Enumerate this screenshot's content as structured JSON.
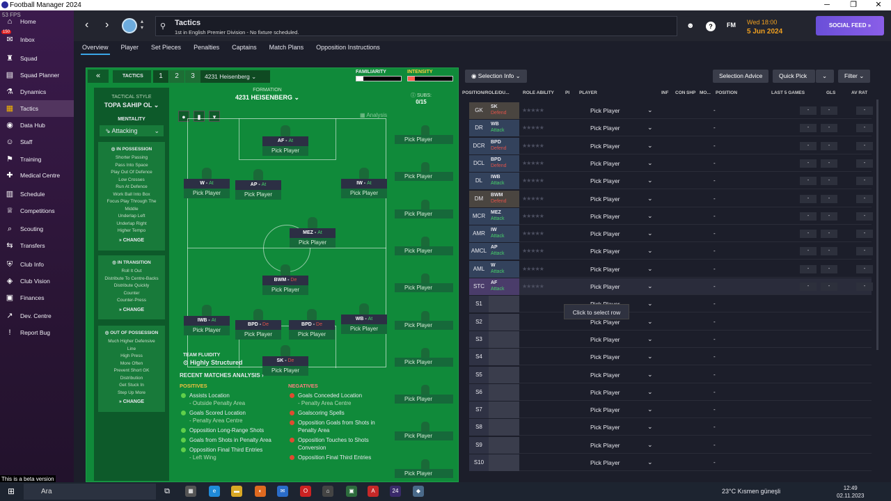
{
  "window": {
    "title": "Football Manager 2024",
    "minimize": "─",
    "maximize": "❐",
    "close": "✕"
  },
  "fps": "53 FPS",
  "beta": "This is a beta version",
  "sidebar": {
    "items": [
      {
        "label": "Home",
        "icon": "⌂"
      },
      {
        "label": "Inbox",
        "icon": "✉",
        "badge": "150"
      },
      {
        "label": "Squad",
        "icon": "♜"
      },
      {
        "label": "Squad Planner",
        "icon": "▤"
      },
      {
        "label": "Dynamics",
        "icon": "⚗"
      },
      {
        "label": "Tactics",
        "icon": "▦"
      },
      {
        "label": "Data Hub",
        "icon": "◉"
      },
      {
        "label": "Staff",
        "icon": "☺"
      },
      {
        "label": "Training",
        "icon": "⚑"
      },
      {
        "label": "Medical Centre",
        "icon": "✚"
      },
      {
        "label": "Schedule",
        "icon": "▥"
      },
      {
        "label": "Competitions",
        "icon": "♕"
      },
      {
        "label": "Scouting",
        "icon": "⌕"
      },
      {
        "label": "Transfers",
        "icon": "⇆"
      },
      {
        "label": "Club Info",
        "icon": "⛨"
      },
      {
        "label": "Club Vision",
        "icon": "◈"
      },
      {
        "label": "Finances",
        "icon": "▣"
      },
      {
        "label": "Dev. Centre",
        "icon": "↗"
      },
      {
        "label": "Report Bug",
        "icon": "!"
      }
    ]
  },
  "header": {
    "title": "Tactics",
    "subtitle": "1st in English Premier Division - No fixture scheduled.",
    "fm": "FM",
    "day": "Wed 18:00",
    "date": "5 Jun 2024",
    "social": "SOCIAL FEED »"
  },
  "tabs": [
    "Overview",
    "Player",
    "Set Pieces",
    "Penalties",
    "Captains",
    "Match Plans",
    "Opposition Instructions"
  ],
  "tactic": {
    "label": "TACTICS",
    "slots": [
      "1",
      "2",
      "3"
    ],
    "name": "4231 Heisenberg",
    "familiarity": "FAMILIARITY",
    "intensity": "INTENSITY",
    "familiarity_level": 0.15,
    "intensity_level": 0.15
  },
  "style": {
    "label": "TACTICAL STYLE",
    "value": "TOPA SAHIP OL",
    "mentality_label": "MENTALITY",
    "mentality": "Attacking"
  },
  "in_possession": {
    "title": "IN POSSESSION",
    "items": [
      "Shorter Passing",
      "Pass Into Space",
      "Play Out Of Defence",
      "Low Crosses",
      "Run At Defence",
      "Work Ball Into Box",
      "Focus Play Through The",
      "Middle",
      "Underlap Left",
      "Underlap Right",
      "Higher Tempo"
    ],
    "change": "CHANGE"
  },
  "in_transition": {
    "title": "IN TRANSITION",
    "items": [
      "Roll It Out",
      "Distribute To Centre-Backs",
      "Distribute Quickly",
      "Counter",
      "Counter-Press"
    ],
    "change": "CHANGE"
  },
  "out_possession": {
    "title": "OUT OF POSSESSION",
    "items": [
      "Much Higher Defensive",
      "Line",
      "High Press",
      "More Often",
      "Prevent Short GK",
      "Distribution",
      "Get Stuck In",
      "Step Up More"
    ],
    "change": "CHANGE"
  },
  "formation": {
    "label": "FORMATION",
    "name": "4231 HEISENBERG",
    "subs_label": "SUBS:",
    "subs": "0/15",
    "analysis": "Analysis"
  },
  "pick": "Pick Player",
  "players": [
    {
      "role": "AF",
      "duty": "At"
    },
    {
      "role": "W",
      "duty": "At"
    },
    {
      "role": "AP",
      "duty": "At"
    },
    {
      "role": "IW",
      "duty": "At"
    },
    {
      "role": "MEZ",
      "duty": "At"
    },
    {
      "role": "BWM",
      "duty": "De"
    },
    {
      "role": "IWB",
      "duty": "At"
    },
    {
      "role": "BPD",
      "duty": "De"
    },
    {
      "role": "BPD",
      "duty": "De"
    },
    {
      "role": "WB",
      "duty": "At"
    },
    {
      "role": "SK",
      "duty": "De"
    }
  ],
  "fluidity": {
    "label": "TEAM FLUIDITY",
    "value": "Highly Structured"
  },
  "recent": "RECENT MATCHES ANALYSIS ›",
  "positives": {
    "title": "POSITIVES",
    "items": [
      {
        "t": "Assists Location",
        "s": "- Outside Penalty Area"
      },
      {
        "t": "Goals Scored Location",
        "s": "- Penalty Area Centre"
      },
      {
        "t": "Opposition Long-Range Shots",
        "s": ""
      },
      {
        "t": "Goals from Shots in Penalty Area",
        "s": ""
      },
      {
        "t": "Opposition Final Third Entries",
        "s": "- Left Wing"
      }
    ]
  },
  "negatives": {
    "title": "NEGATIVES",
    "items": [
      {
        "t": "Goals Conceded Location",
        "s": "- Penalty Area Centre"
      },
      {
        "t": "Goalscoring Spells",
        "s": ""
      },
      {
        "t": "Opposition Goals from Shots in Penalty Area",
        "s": ""
      },
      {
        "t": "Opposition Touches to Shots Conversion",
        "s": ""
      },
      {
        "t": "Opposition Final Third Entries",
        "s": ""
      }
    ]
  },
  "right": {
    "selection_info": "◉ Selection Info ⌄",
    "selection_advice": "Selection Advice",
    "quick_pick": "Quick Pick",
    "filter": "Filter ⌄",
    "headers": [
      "POSITION/ROLE/DU...",
      "ROLE ABILITY",
      "PI",
      "PLAYER",
      "INF",
      "CON",
      "SHP",
      "MO...",
      "POSITION",
      "LAST 5 GAMES",
      "GLS",
      "AV RAT"
    ],
    "rows": [
      {
        "pos": "GK",
        "role": "SK",
        "duty": "Defend"
      },
      {
        "pos": "DR",
        "role": "WB",
        "duty": "Attack"
      },
      {
        "pos": "DCR",
        "role": "BPD",
        "duty": "Defend"
      },
      {
        "pos": "DCL",
        "role": "BPD",
        "duty": "Defend"
      },
      {
        "pos": "DL",
        "role": "IWB",
        "duty": "Attack"
      },
      {
        "pos": "DM",
        "role": "BWM",
        "duty": "Defend"
      },
      {
        "pos": "MCR",
        "role": "MEZ",
        "duty": "Attack"
      },
      {
        "pos": "AMR",
        "role": "IW",
        "duty": "Attack"
      },
      {
        "pos": "AMCL",
        "role": "AP",
        "duty": "Attack"
      },
      {
        "pos": "AML",
        "role": "W",
        "duty": "Attack"
      },
      {
        "pos": "STC",
        "role": "AF",
        "duty": "Attack"
      },
      {
        "pos": "S1"
      },
      {
        "pos": "S2"
      },
      {
        "pos": "S3"
      },
      {
        "pos": "S4"
      },
      {
        "pos": "S5"
      },
      {
        "pos": "S6"
      },
      {
        "pos": "S7"
      },
      {
        "pos": "S8"
      },
      {
        "pos": "S9"
      },
      {
        "pos": "S10"
      }
    ],
    "dash": "-",
    "stars": "★★★★★"
  },
  "tooltip": "Click to select row",
  "taskbar": {
    "search": "Ara",
    "weather": "23°C  Kısmen güneşli",
    "time": "12:49",
    "date": "02.11.2023"
  },
  "colors": {
    "attack": "#47d36a",
    "defend": "#e0534a",
    "pitch": "#108a3a",
    "accent": "#6a4fd8"
  }
}
